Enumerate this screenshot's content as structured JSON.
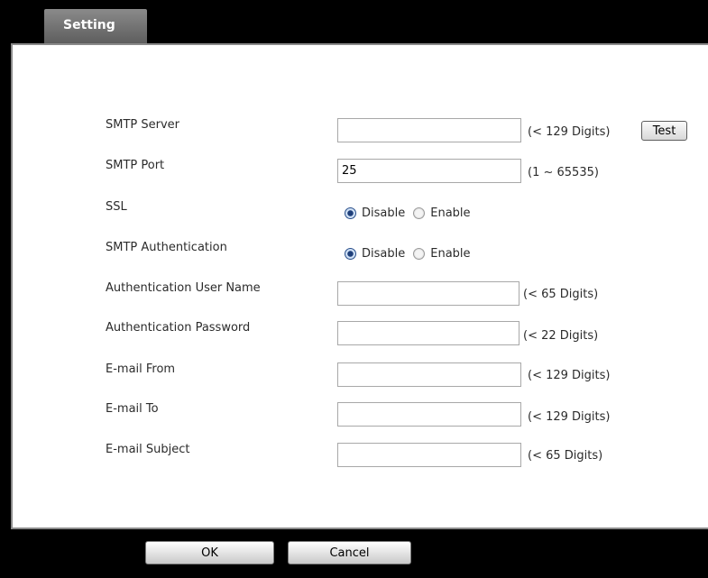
{
  "tab": {
    "label": "Setting"
  },
  "form": {
    "smtp_server": {
      "label": "SMTP Server",
      "value": "",
      "hint": "(< 129 Digits)",
      "test_label": "Test"
    },
    "smtp_port": {
      "label": "SMTP Port",
      "value": "25",
      "hint": "(1 ~ 65535)"
    },
    "ssl": {
      "label": "SSL",
      "options": [
        "Disable",
        "Enable"
      ],
      "selected": "Disable"
    },
    "smtp_auth": {
      "label": "SMTP Authentication",
      "options": [
        "Disable",
        "Enable"
      ],
      "selected": "Disable"
    },
    "auth_user": {
      "label": "Authentication User Name",
      "value": "",
      "hint": "(< 65 Digits)"
    },
    "auth_password": {
      "label": "Authentication Password",
      "value": "",
      "hint": "(< 22 Digits)"
    },
    "email_from": {
      "label": "E-mail From",
      "value": "",
      "hint": "(< 129 Digits)"
    },
    "email_to": {
      "label": "E-mail To",
      "value": "",
      "hint": "(< 129 Digits)"
    },
    "email_subject": {
      "label": "E-mail Subject",
      "value": "",
      "hint": "(< 65 Digits)"
    }
  },
  "buttons": {
    "ok": "OK",
    "cancel": "Cancel"
  }
}
